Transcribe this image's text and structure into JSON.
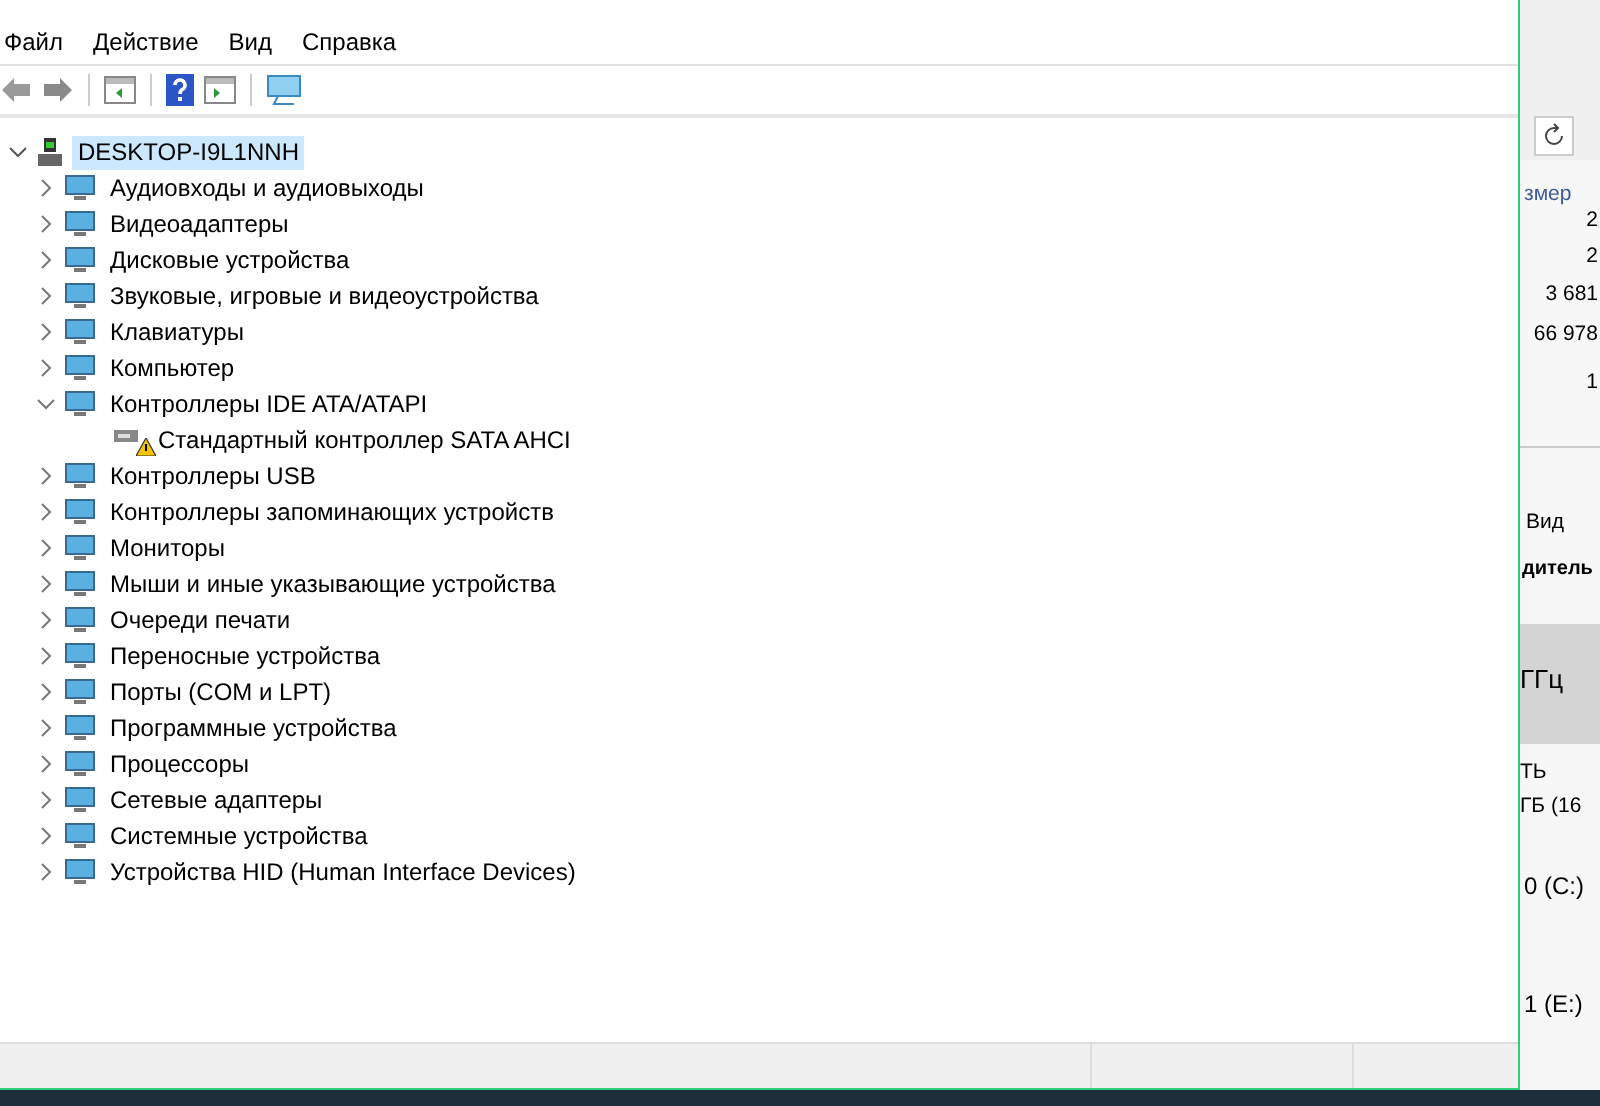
{
  "menu": [
    "Файл",
    "Действие",
    "Вид",
    "Справка"
  ],
  "tree": {
    "label": "DESKTOP-I9L1NNH",
    "expanded": true,
    "selected": true,
    "children": [
      {
        "label": "Аудиовходы и аудиовыходы",
        "expanded": false
      },
      {
        "label": "Видеоадаптеры",
        "expanded": false
      },
      {
        "label": "Дисковые устройства",
        "expanded": false
      },
      {
        "label": "Звуковые, игровые и видеоустройства",
        "expanded": false
      },
      {
        "label": "Клавиатуры",
        "expanded": false
      },
      {
        "label": "Компьютер",
        "expanded": false
      },
      {
        "label": "Контроллеры IDE ATA/ATAPI",
        "expanded": true,
        "children": [
          {
            "label": "Стандартный контроллер SATA AHCI",
            "warning": true
          }
        ]
      },
      {
        "label": "Контроллеры USB",
        "expanded": false
      },
      {
        "label": "Контроллеры запоминающих устройств",
        "expanded": false
      },
      {
        "label": "Мониторы",
        "expanded": false
      },
      {
        "label": "Мыши и иные указывающие устройства",
        "expanded": false
      },
      {
        "label": "Очереди печати",
        "expanded": false
      },
      {
        "label": "Переносные устройства",
        "expanded": false
      },
      {
        "label": "Порты (COM и LPT)",
        "expanded": false
      },
      {
        "label": "Программные устройства",
        "expanded": false
      },
      {
        "label": "Процессоры",
        "expanded": false
      },
      {
        "label": "Сетевые адаптеры",
        "expanded": false
      },
      {
        "label": "Системные устройства",
        "expanded": false
      },
      {
        "label": "Устройства HID (Human Interface Devices)",
        "expanded": false
      }
    ]
  },
  "background_window": {
    "column_header": "змер",
    "sizes": [
      "2",
      "2",
      "3 681",
      "66 978",
      "1"
    ],
    "tab": "Вид",
    "label_1": "дитель",
    "cpu": "ГГц",
    "label_2": "ТЬ",
    "memory": "ГБ (16",
    "drives": [
      "0 (C:)",
      "1 (E:)"
    ]
  }
}
